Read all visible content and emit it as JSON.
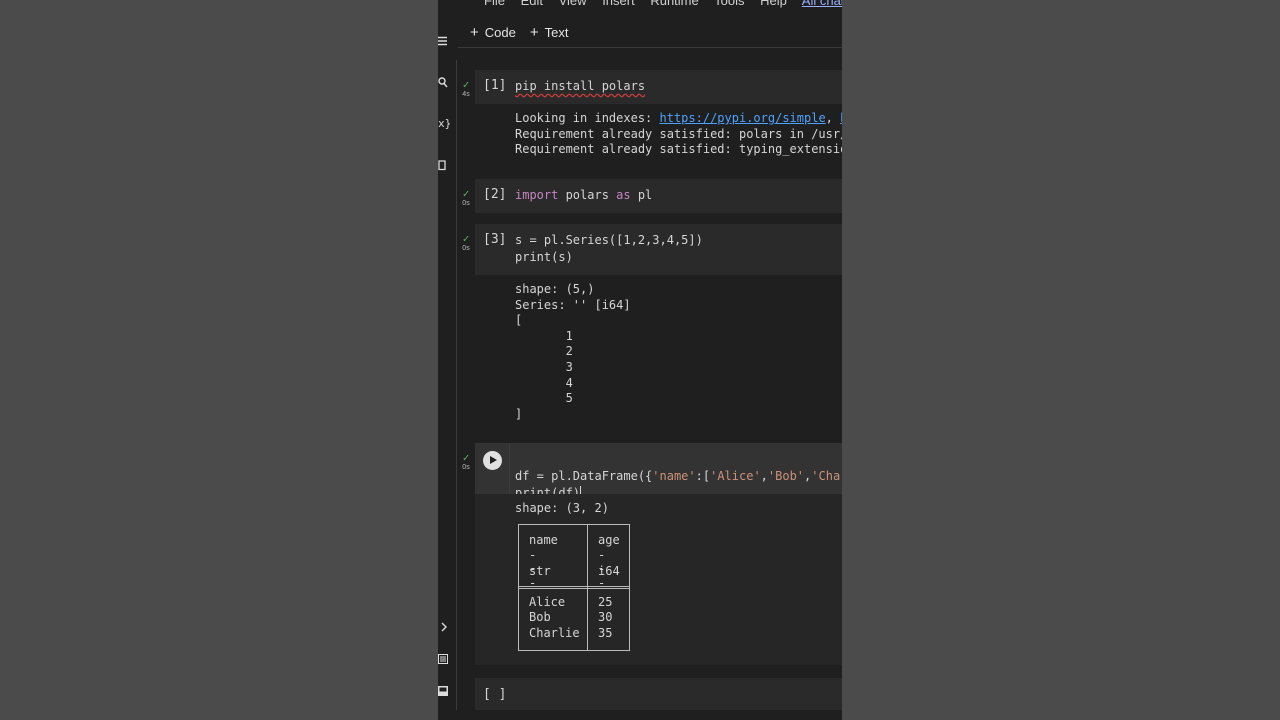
{
  "menu": {
    "items": [
      "File",
      "Edit",
      "View",
      "Insert",
      "Runtime",
      "Tools",
      "Help"
    ],
    "saved_status": "All changes"
  },
  "toolbar": {
    "code_label": "Code",
    "text_label": "Text"
  },
  "icons": [
    "menu-icon",
    "search-icon",
    "variables-icon",
    "files-icon",
    "expand-icon",
    "command-palette-icon",
    "terminal-icon"
  ],
  "cells": [
    {
      "count": "[1]",
      "time": "4s",
      "source": "pip install polars",
      "output": {
        "line1_prefix": "Looking in indexes: ",
        "line1_link1": "https://pypi.org/simple",
        "line1_sep": ", ",
        "line1_link2": "htt",
        "line2": "Requirement already satisfied: polars in /usr/lo",
        "line3": "Requirement already satisfied: typing_extensions"
      }
    },
    {
      "count": "[2]",
      "time": "0s",
      "kw_import": "import",
      "module": " polars ",
      "kw_as": "as",
      "alias": " pl"
    },
    {
      "count": "[3]",
      "time": "0s",
      "source_line1": "s = pl.Series([1,2,3,4,5])",
      "source_line2": "print(s)",
      "output": "shape: (5,)\nSeries: '' [i64]\n[\n\t1\n\t2\n\t3\n\t4\n\t5\n]"
    },
    {
      "time": "0s",
      "code_prefix": "df = pl.DataFrame({",
      "str_name": "'name'",
      "colon_bracket": ":[",
      "str_alice": "'Alice'",
      "comma1": ",",
      "str_bob": "'Bob'",
      "comma2": ",",
      "str_charlie": "'Charli",
      "source_line2": "print(df)",
      "output_shape": "shape: (3, 2)",
      "table": {
        "columns": [
          {
            "name": "name",
            "dashes": "---",
            "dtype": "str",
            "values": [
              "Alice",
              "Bob",
              "Charlie"
            ]
          },
          {
            "name": "age",
            "dashes": "---",
            "dtype": "i64",
            "values": [
              "25",
              "30",
              "35"
            ]
          }
        ]
      }
    },
    {
      "count": "[ ]"
    }
  ],
  "colors": {
    "check": "#57b65b",
    "link": "#4ea2ff",
    "keyword": "#c586c0",
    "string": "#ce9178"
  }
}
